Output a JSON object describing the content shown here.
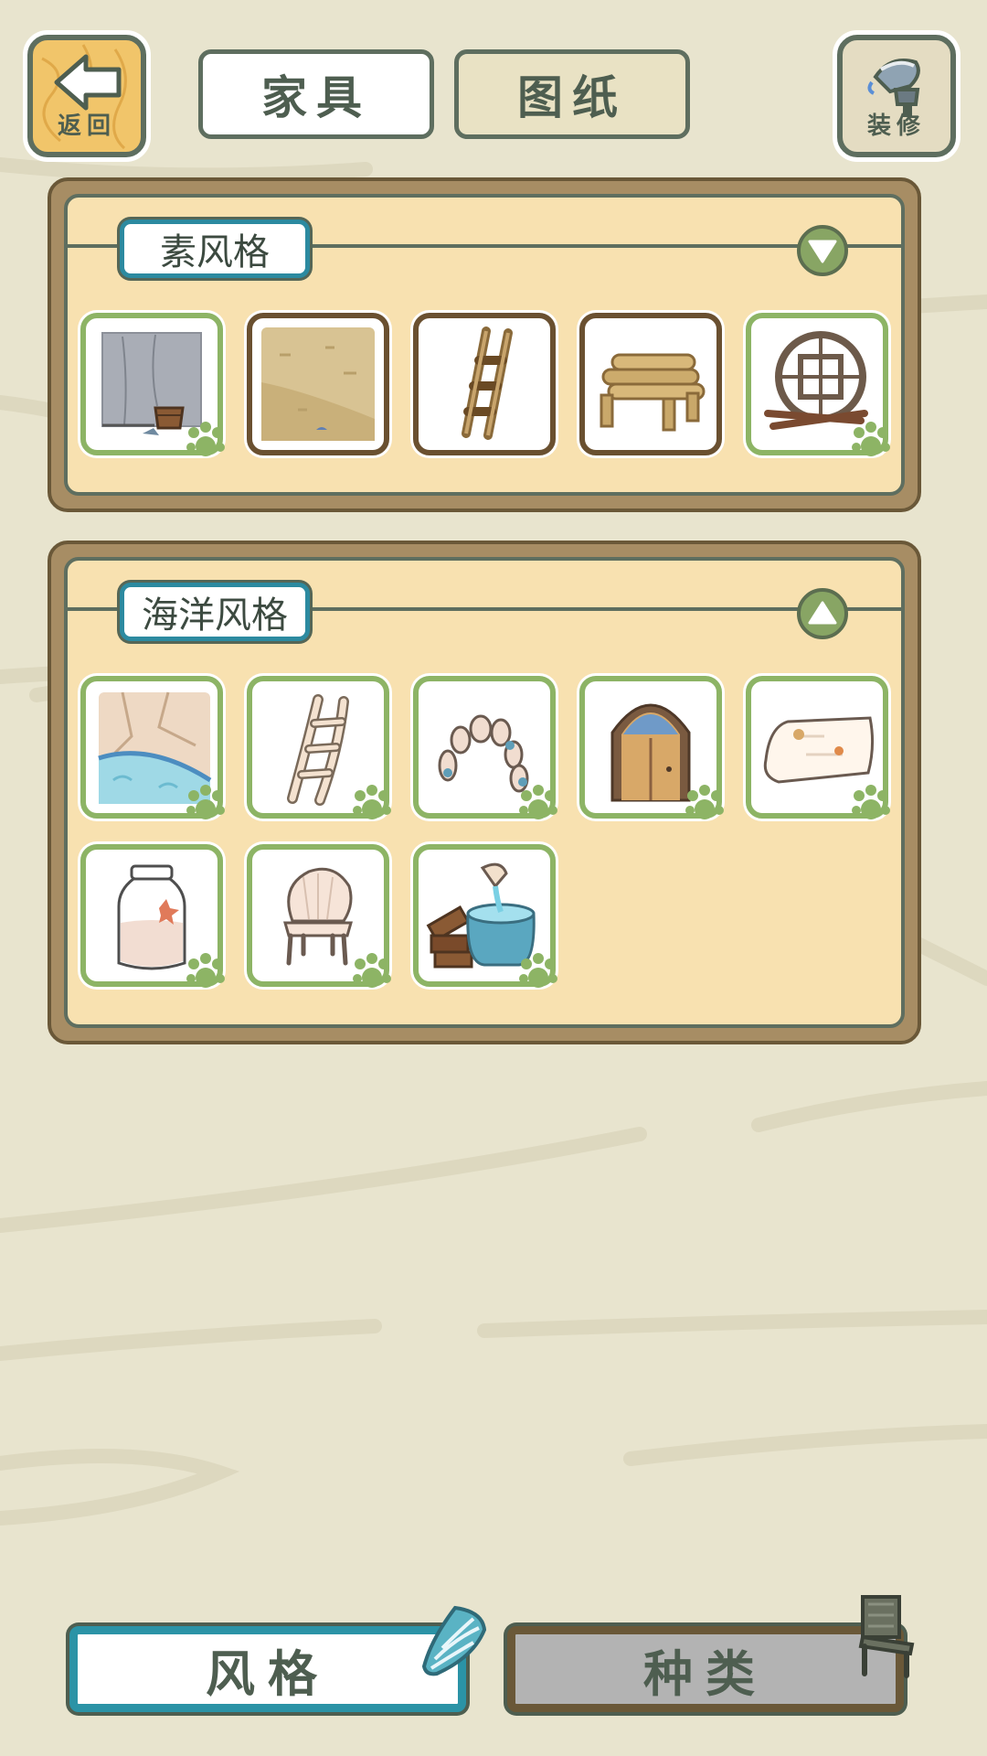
{
  "header": {
    "back_label": "返回",
    "tabs": [
      {
        "label": "家具",
        "active": true
      },
      {
        "label": "图纸",
        "active": false
      }
    ],
    "decorate_label": "装修"
  },
  "sections": [
    {
      "title": "素风格",
      "expanded": false,
      "toggle_icon": "chevron-down-icon",
      "items": [
        {
          "icon": "plain-wall-bucket-icon",
          "owned": true
        },
        {
          "icon": "sand-floor-icon",
          "owned": false
        },
        {
          "icon": "wooden-ladder-icon",
          "owned": false
        },
        {
          "icon": "log-pile-table-icon",
          "owned": false
        },
        {
          "icon": "round-lattice-window-icon",
          "owned": true
        }
      ]
    },
    {
      "title": "海洋风格",
      "expanded": true,
      "toggle_icon": "chevron-up-icon",
      "items": [
        {
          "icon": "ocean-floor-icon",
          "owned": true
        },
        {
          "icon": "driftwood-ladder-icon",
          "owned": true
        },
        {
          "icon": "pebble-arch-icon",
          "owned": true
        },
        {
          "icon": "arched-door-icon",
          "owned": true
        },
        {
          "icon": "treasure-map-icon",
          "owned": true
        },
        {
          "icon": "sand-bottle-icon",
          "owned": true
        },
        {
          "icon": "shell-chair-icon",
          "owned": true
        },
        {
          "icon": "water-basin-icon",
          "owned": true
        }
      ]
    }
  ],
  "bottom_tabs": [
    {
      "label": "风格",
      "active": true,
      "icon": "seashell-icon"
    },
    {
      "label": "种类",
      "active": false,
      "icon": "chair-icon"
    }
  ],
  "colors": {
    "background": "#e8e4ce",
    "panel_frame": "#a78d64",
    "panel_fill": "#f8e1b0",
    "accent_teal": "#2b93a6",
    "owned_border": "#8db465",
    "locked_border": "#6a5030"
  }
}
